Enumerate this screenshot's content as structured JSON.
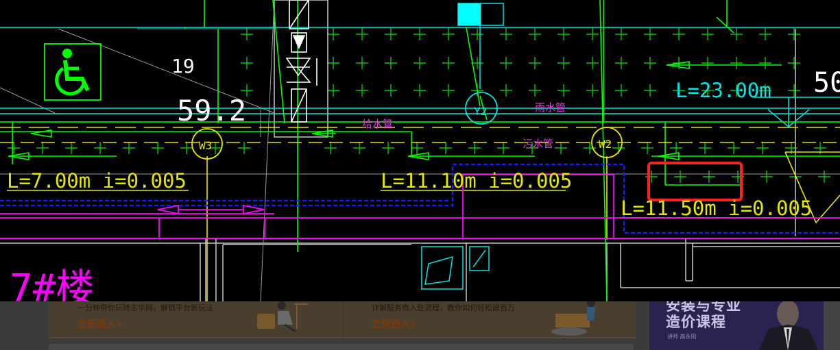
{
  "cad": {
    "number_19": "19",
    "number_592": "59.2",
    "number_50": "50",
    "label_rain_pipe": "雨水管",
    "label_water_supply": "给水管",
    "label_sewage": "污水管",
    "manhole_y2": "Y2",
    "manhole_w3": "W3",
    "manhole_w2": "W2",
    "dim_1": "L=7.00m i=0.005",
    "dim_2": "L=11.10m i=0.005",
    "dim_3": "L=11.50m i=0.005",
    "dim_4": "L=23.00m",
    "building_label": "7#楼",
    "colors": {
      "background": "#000000",
      "green_line": "#00ff00",
      "cyan_line": "#00e5e5",
      "yellow_line": "#ffff00",
      "blue_line": "#0000ff",
      "magenta_line": "#ff00ff",
      "highlight_box": "#ff2020",
      "chinese_label": "#e040e0"
    }
  },
  "ads": {
    "card1": {
      "desc": "一分钟带你玩转志华网，解锁平台新玩法",
      "link": "立即进入"
    },
    "card2": {
      "desc": "详解服务商入驻流程，教你如何轻松破百万",
      "link": "立即进入"
    },
    "link_arrow": "»"
  },
  "course": {
    "line1": "安装与专业",
    "line2": "造价课程",
    "teacher": "讲师 高永阳"
  }
}
